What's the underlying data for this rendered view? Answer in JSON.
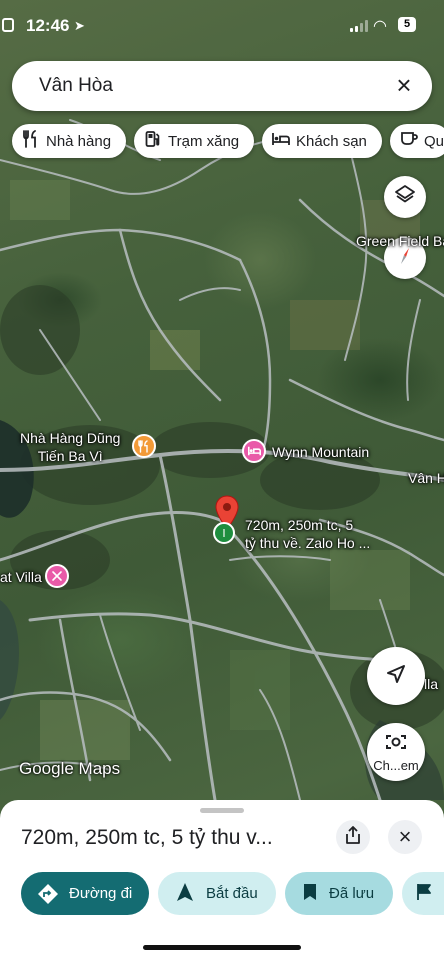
{
  "status_bar": {
    "time": "12:46",
    "battery": "5"
  },
  "search": {
    "query": "Vân Hòa"
  },
  "chips": [
    {
      "label": "Nhà hàng",
      "icon": "fork-knife-icon"
    },
    {
      "label": "Trạm xăng",
      "icon": "gas-station-icon"
    },
    {
      "label": "Khách sạn",
      "icon": "bed-icon"
    },
    {
      "label": "Qu",
      "icon": "coffee-cup-icon"
    }
  ],
  "map": {
    "labels": {
      "green_field": "Green Field Ba",
      "restaurant_line1": "Nhà Hàng Dũng",
      "restaurant_line2": "Tiến Ba Vì",
      "wynn": "Wynn Mountain",
      "van_hoa": "Vân H",
      "pin_line1": "720m, 250m tc, 5",
      "pin_line2": "tỷ thu về. Zalo Ho ...",
      "villa": "at Villa",
      "right_villa": "lla"
    },
    "watermark": "Google Maps",
    "pin_color": "#ea4335",
    "restaurant_color": "#f29a38",
    "hotel_color": "#e95aa8",
    "villa_color": "#e95aa8",
    "map_type_button": "layers-icon",
    "compass_button": "compass-icon",
    "location_button": "navigation-arrow-icon",
    "lens_label": "Ch...em"
  },
  "sheet": {
    "title": "720m, 250m tc, 5 tỷ thu v...",
    "actions": [
      {
        "label": "Đường đi",
        "icon": "directions-icon"
      },
      {
        "label": "Bắt đầu",
        "icon": "navigation-icon"
      },
      {
        "label": "Đã lưu",
        "icon": "bookmark-icon"
      },
      {
        "label": "",
        "icon": "flag-icon"
      }
    ]
  },
  "colors": {
    "primary": "#0b57d0",
    "teal": "#146c72",
    "light_action": "#d3e3fd"
  }
}
